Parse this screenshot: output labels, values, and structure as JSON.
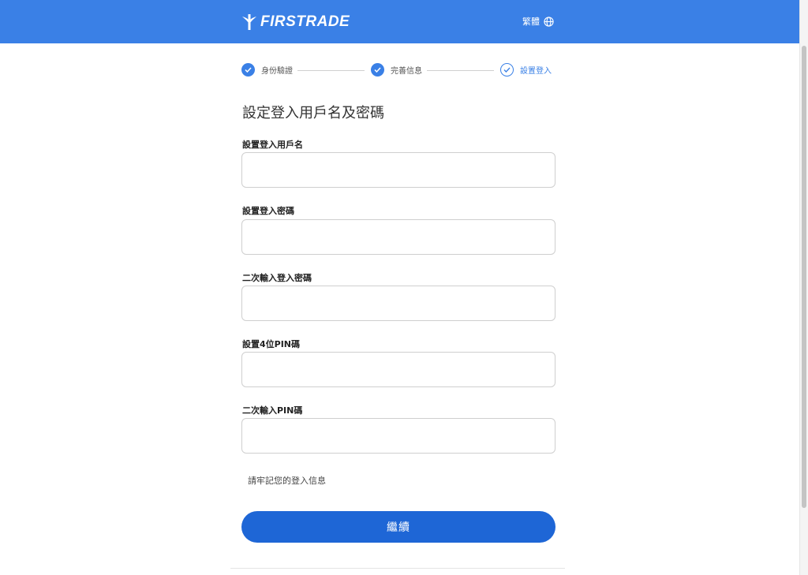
{
  "header": {
    "brand": "FIRSTRADE",
    "language_label": "繁體",
    "accent_color": "#3a80e6",
    "icons": {
      "logo": "firstrade-logo-icon",
      "language": "globe-icon"
    }
  },
  "steps": [
    {
      "label": "身份驗證",
      "status": "completed"
    },
    {
      "label": "完善信息",
      "status": "completed"
    },
    {
      "label": "設置登入",
      "status": "current"
    }
  ],
  "form": {
    "title": "設定登入用戶名及密碼",
    "fields": [
      {
        "label": "設置登入用戶名",
        "value": ""
      },
      {
        "label": "設置登入密碼",
        "value": ""
      },
      {
        "label": "二次輸入登入密碼",
        "value": ""
      },
      {
        "label": "設置4位PIN碼",
        "value": ""
      },
      {
        "label": "二次輸入PIN碼",
        "value": ""
      }
    ],
    "note": "請牢記您的登入信息",
    "continue_label": "繼續",
    "button_color": "#1e66d6"
  }
}
